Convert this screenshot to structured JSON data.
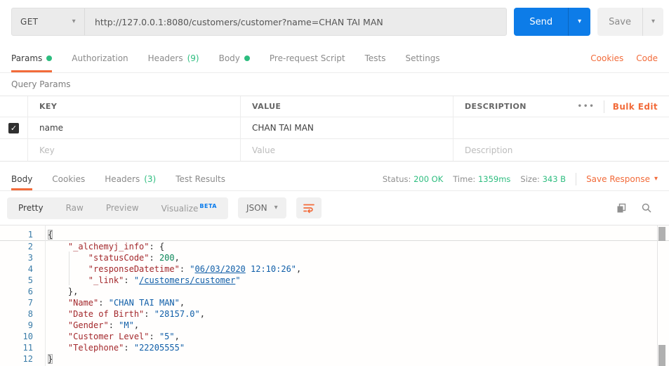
{
  "colors": {
    "orange": "#f26b3a",
    "green": "#2dbd7f",
    "blue": "#0d7ce8",
    "beta-blue": "#097bed",
    "code-key": "#a3282c",
    "code-str": "#0f5ea8",
    "code-num": "#098658",
    "line-num": "#3a7ca8"
  },
  "request_bar": {
    "method": "GET",
    "url": "http://127.0.0.1:8080/customers/customer?name=CHAN TAI MAN",
    "send_label": "Send",
    "save_label": "Save"
  },
  "request_tabs": {
    "items": [
      {
        "label": "Params",
        "dot": true,
        "active": true
      },
      {
        "label": "Authorization"
      },
      {
        "label": "Headers",
        "count": "(9)"
      },
      {
        "label": "Body",
        "dot": true
      },
      {
        "label": "Pre-request Script"
      },
      {
        "label": "Tests"
      },
      {
        "label": "Settings"
      }
    ],
    "cookies": "Cookies",
    "code": "Code"
  },
  "query_params": {
    "title": "Query Params",
    "col_key": "KEY",
    "col_value": "VALUE",
    "col_description": "DESCRIPTION",
    "more": "•••",
    "bulk_edit": "Bulk Edit",
    "row": {
      "checked": true,
      "key": "name",
      "value": "CHAN TAI MAN",
      "description": ""
    },
    "placeholders": {
      "key": "Key",
      "value": "Value",
      "description": "Description"
    }
  },
  "response": {
    "tabs": [
      {
        "label": "Body",
        "active": true
      },
      {
        "label": "Cookies"
      },
      {
        "label": "Headers",
        "count": "(3)"
      },
      {
        "label": "Test Results"
      }
    ],
    "status_label": "Status:",
    "status_value": "200 OK",
    "time_label": "Time:",
    "time_value": "1359ms",
    "size_label": "Size:",
    "size_value": "343 B",
    "save_response": "Save Response"
  },
  "viewer": {
    "modes": [
      "Pretty",
      "Raw",
      "Preview",
      "Visualize"
    ],
    "beta": "BETA",
    "active_mode": "Pretty",
    "format": "JSON"
  },
  "code": {
    "lines": [
      {
        "num": 1,
        "tokens": [
          {
            "t": "hl",
            "v": "{"
          }
        ]
      },
      {
        "num": 2,
        "tokens": [
          {
            "t": "p",
            "v": "    "
          },
          {
            "t": "k",
            "v": "\"_alchemyj_info\""
          },
          {
            "t": "p",
            "v": ": {"
          }
        ]
      },
      {
        "num": 3,
        "tokens": [
          {
            "t": "p",
            "v": "        "
          },
          {
            "t": "k",
            "v": "\"statusCode\""
          },
          {
            "t": "p",
            "v": ": "
          },
          {
            "t": "n",
            "v": "200"
          },
          {
            "t": "p",
            "v": ","
          }
        ]
      },
      {
        "num": 4,
        "tokens": [
          {
            "t": "p",
            "v": "        "
          },
          {
            "t": "k",
            "v": "\"responseDatetime\""
          },
          {
            "t": "p",
            "v": ": "
          },
          {
            "t": "s",
            "v": "\""
          },
          {
            "t": "sl",
            "v": "06/03/2020"
          },
          {
            "t": "s",
            "v": " 12:10:26\""
          },
          {
            "t": "p",
            "v": ","
          }
        ]
      },
      {
        "num": 5,
        "tokens": [
          {
            "t": "p",
            "v": "        "
          },
          {
            "t": "k",
            "v": "\"_link\""
          },
          {
            "t": "p",
            "v": ": "
          },
          {
            "t": "s",
            "v": "\""
          },
          {
            "t": "sl",
            "v": "/customers/customer"
          },
          {
            "t": "s",
            "v": "\""
          }
        ]
      },
      {
        "num": 6,
        "tokens": [
          {
            "t": "p",
            "v": "    },"
          }
        ]
      },
      {
        "num": 7,
        "tokens": [
          {
            "t": "p",
            "v": "    "
          },
          {
            "t": "k",
            "v": "\"Name\""
          },
          {
            "t": "p",
            "v": ": "
          },
          {
            "t": "s",
            "v": "\"CHAN TAI MAN\""
          },
          {
            "t": "p",
            "v": ","
          }
        ]
      },
      {
        "num": 8,
        "tokens": [
          {
            "t": "p",
            "v": "    "
          },
          {
            "t": "k",
            "v": "\"Date of Birth\""
          },
          {
            "t": "p",
            "v": ": "
          },
          {
            "t": "s",
            "v": "\"28157.0\""
          },
          {
            "t": "p",
            "v": ","
          }
        ]
      },
      {
        "num": 9,
        "tokens": [
          {
            "t": "p",
            "v": "    "
          },
          {
            "t": "k",
            "v": "\"Gender\""
          },
          {
            "t": "p",
            "v": ": "
          },
          {
            "t": "s",
            "v": "\"M\""
          },
          {
            "t": "p",
            "v": ","
          }
        ]
      },
      {
        "num": 10,
        "tokens": [
          {
            "t": "p",
            "v": "    "
          },
          {
            "t": "k",
            "v": "\"Customer Level\""
          },
          {
            "t": "p",
            "v": ": "
          },
          {
            "t": "s",
            "v": "\"5\""
          },
          {
            "t": "p",
            "v": ","
          }
        ]
      },
      {
        "num": 11,
        "tokens": [
          {
            "t": "p",
            "v": "    "
          },
          {
            "t": "k",
            "v": "\"Telephone\""
          },
          {
            "t": "p",
            "v": ": "
          },
          {
            "t": "s",
            "v": "\"22205555\""
          }
        ]
      },
      {
        "num": 12,
        "tokens": [
          {
            "t": "hl",
            "v": "}"
          }
        ]
      }
    ]
  }
}
